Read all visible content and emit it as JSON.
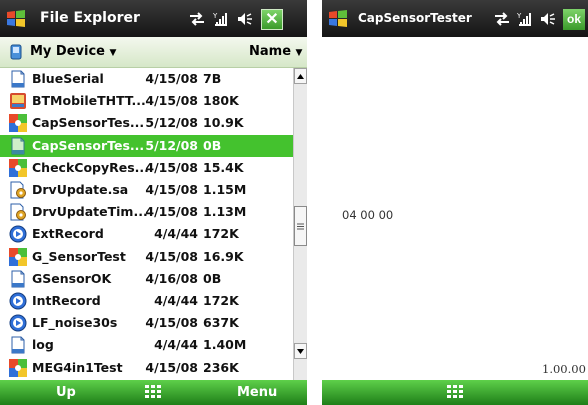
{
  "left_window": {
    "title": "File Explorer",
    "location": "My Device",
    "sort_label": "Name",
    "files": [
      {
        "name": "BlueSerial",
        "date": "4/15/08",
        "size": "7B",
        "icon": "document-icon",
        "selected": false
      },
      {
        "name": "BTMobileTHTT...",
        "date": "4/15/08",
        "size": "180K",
        "icon": "application-icon",
        "selected": false
      },
      {
        "name": "CapSensorTes...",
        "date": "5/12/08",
        "size": "10.9K",
        "icon": "colorful-app-icon",
        "selected": false
      },
      {
        "name": "CapSensorTes...",
        "date": "5/12/08",
        "size": "0B",
        "icon": "document-icon",
        "selected": true
      },
      {
        "name": "CheckCopyRes...",
        "date": "4/15/08",
        "size": "15.4K",
        "icon": "colorful-app-icon",
        "selected": false
      },
      {
        "name": "DrvUpdate.sa",
        "date": "4/15/08",
        "size": "1.15M",
        "icon": "settings-file-icon",
        "selected": false
      },
      {
        "name": "DrvUpdateTim...",
        "date": "4/15/08",
        "size": "1.13M",
        "icon": "settings-file-icon",
        "selected": false
      },
      {
        "name": "ExtRecord",
        "date": "4/4/44",
        "size": "172K",
        "icon": "media-icon",
        "selected": false
      },
      {
        "name": "G_SensorTest",
        "date": "4/15/08",
        "size": "16.9K",
        "icon": "colorful-app-icon",
        "selected": false
      },
      {
        "name": "GSensorOK",
        "date": "4/16/08",
        "size": "0B",
        "icon": "document-icon",
        "selected": false
      },
      {
        "name": "IntRecord",
        "date": "4/4/44",
        "size": "172K",
        "icon": "media-icon",
        "selected": false
      },
      {
        "name": "LF_noise30s",
        "date": "4/15/08",
        "size": "637K",
        "icon": "media-icon",
        "selected": false
      },
      {
        "name": "log",
        "date": "4/4/44",
        "size": "1.40M",
        "icon": "document-icon",
        "selected": false
      },
      {
        "name": "MEG4in1Test",
        "date": "4/15/08",
        "size": "236K",
        "icon": "colorful-app-icon",
        "selected": false
      }
    ],
    "softkey_left": "Up",
    "softkey_right": "Menu"
  },
  "right_window": {
    "title": "CapSensorTester",
    "ok_label": "ok",
    "reading": "04 00 00",
    "version": "1.00.00"
  },
  "colors": {
    "selection": "#44c22e",
    "softbar": "#3aa82a",
    "titlebar": "#222222"
  }
}
